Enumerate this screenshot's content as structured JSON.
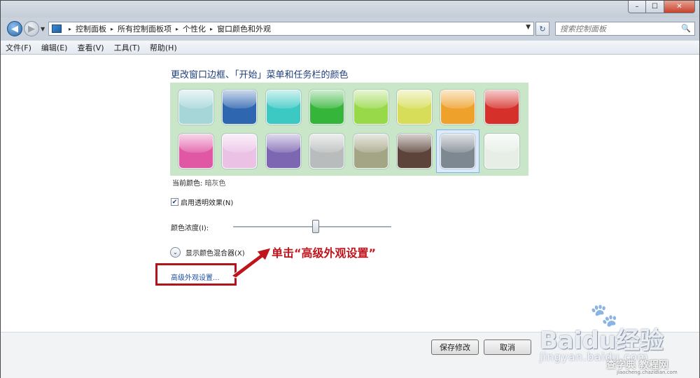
{
  "window": {
    "caption_min": "–",
    "caption_max": "☐",
    "caption_close": "✕"
  },
  "nav": {
    "back_glyph": "◀",
    "forward_glyph": "▶",
    "dropdown_glyph": "▼",
    "refresh_glyph": "↻",
    "search_glyph": "🔍"
  },
  "breadcrumb": {
    "sep": "▸",
    "items": [
      "控制面板",
      "所有控制面板项",
      "个性化",
      "窗口颜色和外观"
    ]
  },
  "search": {
    "placeholder": "搜索控制面板"
  },
  "menu": [
    "文件(F)",
    "编辑(E)",
    "查看(V)",
    "工具(T)",
    "帮助(H)"
  ],
  "page": {
    "heading": "更改窗口边框、「开始」菜单和任务栏的颜色",
    "current_color_label": "当前颜色:",
    "current_color_value": "暗灰色",
    "transparency_label": "启用透明效果(N)",
    "transparency_checked": "✔",
    "intensity_label": "颜色浓度(I):",
    "intensity_value": 0.52,
    "mixer_label": "显示颜色混合器(X)",
    "mixer_glyph": "⌄",
    "advanced_link": "高级外观设置..."
  },
  "swatches": [
    {
      "name": "sky",
      "color": "#a6d6d8"
    },
    {
      "name": "twilight",
      "color": "#2f66b0"
    },
    {
      "name": "sea",
      "color": "#3cc9c4"
    },
    {
      "name": "leaf",
      "color": "#35b63a"
    },
    {
      "name": "lime",
      "color": "#98d94a"
    },
    {
      "name": "lemon",
      "color": "#d7dd58"
    },
    {
      "name": "pumpkin",
      "color": "#eea22c"
    },
    {
      "name": "ruby",
      "color": "#d6302a"
    },
    {
      "name": "fuchsia",
      "color": "#e057a4"
    },
    {
      "name": "blush",
      "color": "#ebc1e6"
    },
    {
      "name": "violet",
      "color": "#7d66b2"
    },
    {
      "name": "lavender",
      "color": "#b9bcbc"
    },
    {
      "name": "taupe",
      "color": "#a4a585"
    },
    {
      "name": "chocolate",
      "color": "#5c443a"
    },
    {
      "name": "slate",
      "color": "#7e8891"
    },
    {
      "name": "frost",
      "color": "#e6eee6"
    }
  ],
  "selected_swatch": "slate",
  "annotation": {
    "text": "单击“高级外观设置”"
  },
  "footer": {
    "save_label": "保存修改",
    "cancel_label": "取消"
  },
  "watermark": {
    "logo": "Baidu经验",
    "url": "jingyan.baidu.com",
    "site": "查字典 教程网",
    "site_url": "jiaocheng.chazidian.com"
  },
  "colors": {
    "accent_red": "#c0141c",
    "link_blue": "#1e50a2",
    "swatch_bg": "#c9e6c9"
  }
}
